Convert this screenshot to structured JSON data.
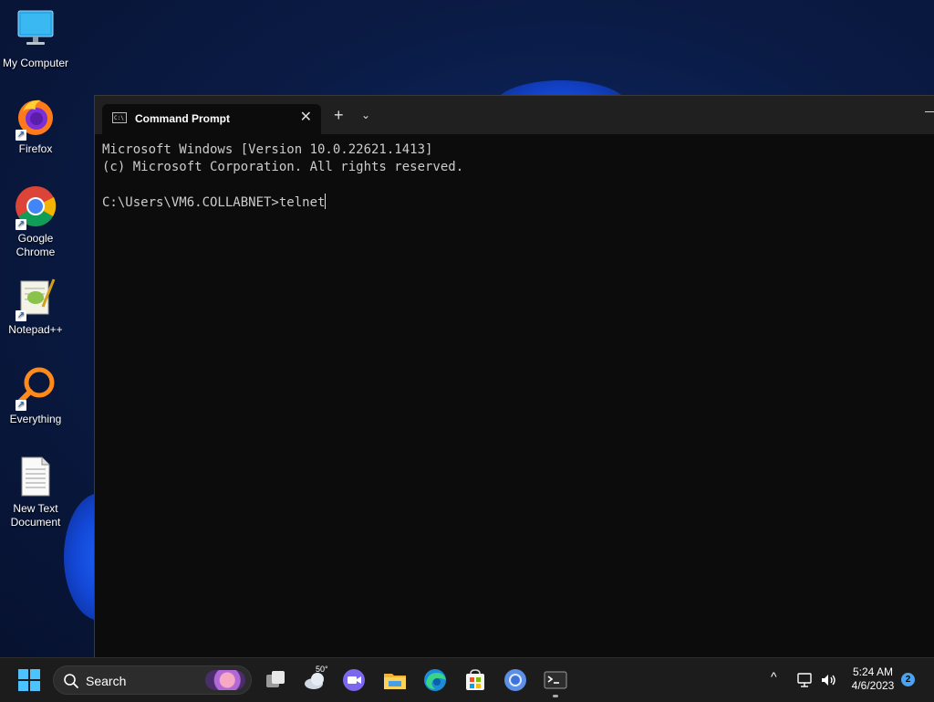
{
  "desktop": {
    "icons": [
      {
        "name": "desktop-icon-my-computer",
        "label": "My Computer"
      },
      {
        "name": "desktop-icon-firefox",
        "label": "Firefox"
      },
      {
        "name": "desktop-icon-google-chrome",
        "label": "Google Chrome"
      },
      {
        "name": "desktop-icon-notepad-plus-plus",
        "label": "Notepad++"
      },
      {
        "name": "desktop-icon-everything",
        "label": "Everything"
      },
      {
        "name": "desktop-icon-new-text-document",
        "label": "New Text Document"
      }
    ]
  },
  "terminal": {
    "tab_title": "Command Prompt",
    "close_glyph": "✕",
    "new_tab_glyph": "+",
    "dropdown_glyph": "⌄",
    "minimize_glyph": "—",
    "lines": [
      "Microsoft Windows [Version 10.0.22621.1413]",
      "(c) Microsoft Corporation. All rights reserved.",
      "",
      "C:\\Users\\VM6.COLLABNET>telnet"
    ],
    "colors": {
      "background": "#0c0c0c",
      "text": "#cccccc",
      "titlebar": "#202020"
    }
  },
  "taskbar": {
    "search_label": "Search",
    "weather_temp": "50°",
    "time": "5:24 AM",
    "date": "4/6/2023",
    "notification_count": "2",
    "tray_chevron": "^",
    "colors": {
      "background": "#1c1c1c",
      "accent": "#4aa3f0"
    }
  }
}
